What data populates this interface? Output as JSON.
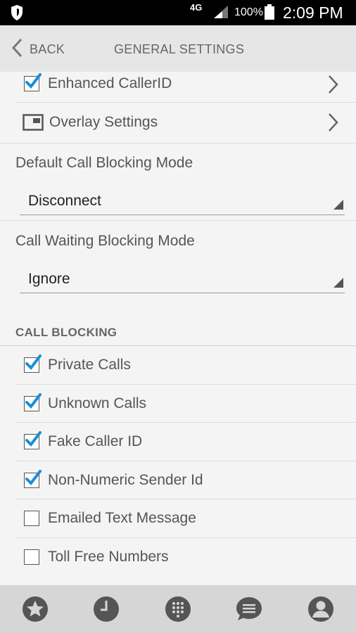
{
  "status_bar": {
    "network": "4G",
    "battery_percent": "100%",
    "time": "2:09 PM"
  },
  "header": {
    "back_label": "BACK",
    "title": "GENERAL SETTINGS"
  },
  "rows": {
    "enhanced_callerid": {
      "label": "Enhanced CallerID",
      "checked": true
    },
    "overlay_settings": {
      "label": "Overlay Settings"
    }
  },
  "default_blocking": {
    "label": "Default Call Blocking Mode",
    "value": "Disconnect"
  },
  "waiting_blocking": {
    "label": "Call Waiting Blocking Mode",
    "value": "Ignore"
  },
  "call_blocking": {
    "title": "CALL BLOCKING",
    "items": [
      {
        "label": "Private Calls",
        "checked": true
      },
      {
        "label": "Unknown Calls",
        "checked": true
      },
      {
        "label": "Fake Caller ID",
        "checked": true
      },
      {
        "label": "Non-Numeric Sender Id",
        "checked": true
      },
      {
        "label": "Emailed Text Message",
        "checked": false
      },
      {
        "label": "Toll Free Numbers",
        "checked": false
      }
    ]
  },
  "bottom_nav": [
    "favorites",
    "history",
    "dialpad",
    "messages",
    "contacts"
  ],
  "colors": {
    "check": "#1a8fd6",
    "header_bg": "#e6e6e6",
    "nav_bg": "#d6d6d6",
    "icon": "#555555"
  }
}
